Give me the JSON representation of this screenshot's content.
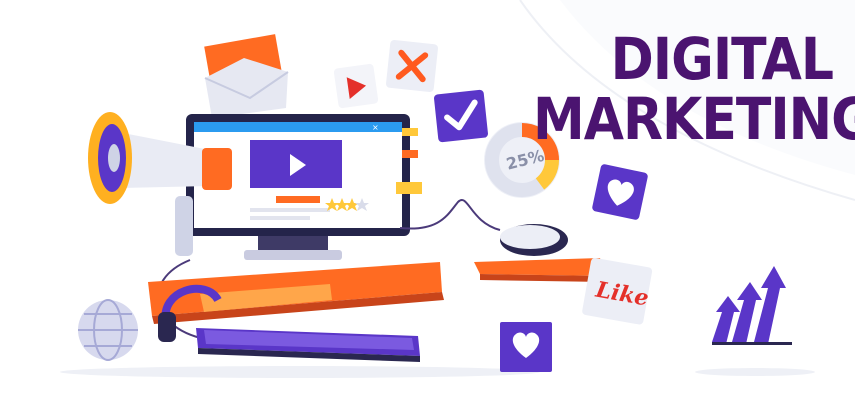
{
  "headline": {
    "line1": "DIGITAL",
    "line2": "MARKETING"
  },
  "donut": {
    "label": "25%",
    "percent": 25
  },
  "like_card": {
    "label": "Like"
  },
  "rating": {
    "stars_filled": 3,
    "stars_total": 4
  },
  "icons": [
    "envelope-icon",
    "play-icon",
    "close-icon",
    "checkmark-icon",
    "megaphone-icon",
    "monitor-icon",
    "donut-chart-icon",
    "heart-icon",
    "computer-mouse-icon",
    "like-sticker-icon",
    "growth-arrows-icon",
    "globe-icon",
    "headphones-icon",
    "keyboard-icon"
  ],
  "colors": {
    "brand_purple": "#4b1470",
    "accent_orange": "#ff6b22",
    "accent_red": "#e4302a",
    "accent_yellow": "#ffc83a",
    "screen_blue": "#2b9bf0"
  }
}
